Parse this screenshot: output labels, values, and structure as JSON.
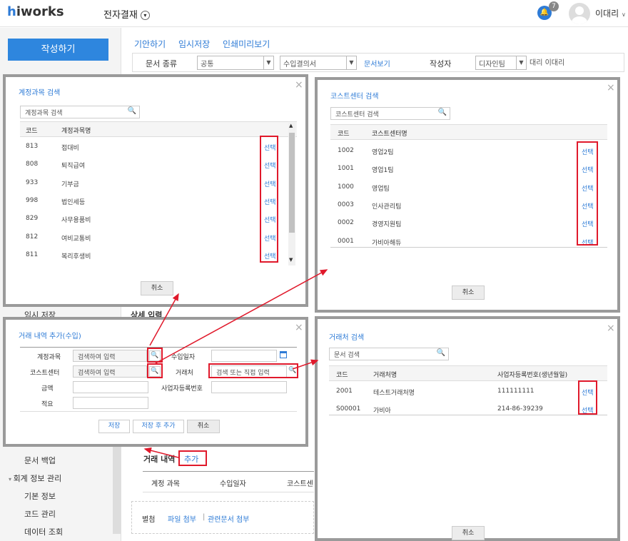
{
  "header": {
    "logo_h": "h",
    "logo_rest": "iworks",
    "app_title": "전자결재",
    "notification_count": "7",
    "user_name": "이대리",
    "icons": {
      "bell": "bell-icon",
      "chevron": "chevron-down-icon",
      "avatar": "avatar-icon"
    }
  },
  "sidebar": {
    "write_button": "작성하기",
    "items": [
      {
        "label": "임시 저장"
      },
      {
        "label": "문서 백업"
      },
      {
        "label": "회계 정보 관리"
      },
      {
        "label": "기본 정보"
      },
      {
        "label": "코드 관리"
      },
      {
        "label": "데이터 조회"
      }
    ]
  },
  "toolbar": {
    "tabs": [
      "기안하기",
      "임시저장",
      "인쇄미리보기"
    ]
  },
  "doc_form": {
    "type_label": "문서 종류",
    "type_value": "공통",
    "form_value": "수입결의서",
    "preview_link": "문서보기",
    "author_label": "작성자",
    "author_value": "디자인팀",
    "author_extra": "대리 이대리"
  },
  "background": {
    "detail_input": "상세 입력",
    "txn_label": "거래 내역",
    "add_button": "추가",
    "columns": [
      "계정 과목",
      "수입일자",
      "코스트센"
    ],
    "attach_label": "별첨",
    "attach_file": "파일 첨부",
    "attach_doc": "관련문서 첨부"
  },
  "account_dialog": {
    "title": "계정과목 검색",
    "search_placeholder": "계정과목 검색",
    "col_code": "코드",
    "col_name": "계정과목명",
    "pick": "선택",
    "cancel": "취소",
    "rows": [
      {
        "code": "813",
        "name": "접대비"
      },
      {
        "code": "808",
        "name": "퇴직급여"
      },
      {
        "code": "933",
        "name": "기부금"
      },
      {
        "code": "998",
        "name": "법인세등"
      },
      {
        "code": "829",
        "name": "사무용품비"
      },
      {
        "code": "812",
        "name": "여비교통비"
      },
      {
        "code": "811",
        "name": "복리후생비"
      }
    ]
  },
  "cost_dialog": {
    "title": "코스트센터 검색",
    "search_placeholder": "코스트센터 검색",
    "col_code": "코드",
    "col_name": "코스트센터명",
    "pick": "선택",
    "cancel": "취소",
    "rows": [
      {
        "code": "1002",
        "name": "영업2팀"
      },
      {
        "code": "1001",
        "name": "영업1팀"
      },
      {
        "code": "1000",
        "name": "영업팀"
      },
      {
        "code": "0003",
        "name": "인사관리팀"
      },
      {
        "code": "0002",
        "name": "경영지원팀"
      },
      {
        "code": "0001",
        "name": "가비아해듀"
      }
    ]
  },
  "txn_dialog": {
    "title": "거래 내역 추가(수입)",
    "account_label": "계정과목",
    "account_placeholder": "검색하여 입력",
    "date_label": "수입일자",
    "cost_label": "코스트센터",
    "cost_placeholder": "검색하여 입력",
    "vendor_label": "거래처",
    "vendor_placeholder": "검색 또는 직접 입력",
    "amount_label": "금액",
    "bizno_label": "사업자등록번호",
    "memo_label": "적요",
    "save": "저장",
    "save_add": "저장 후 추가",
    "cancel": "취소"
  },
  "vendor_dialog": {
    "title": "거래처 검색",
    "search_value": "문서 검색",
    "col_code": "코드",
    "col_name": "거래처명",
    "col_bizno": "사업자등록번호(생년월일)",
    "pick": "선택",
    "cancel": "취소",
    "rows": [
      {
        "code": "2001",
        "name": "테스트거래처명",
        "bizno": "111111111"
      },
      {
        "code": "S00001",
        "name": "가비아",
        "bizno": "214-86-39239"
      }
    ]
  }
}
